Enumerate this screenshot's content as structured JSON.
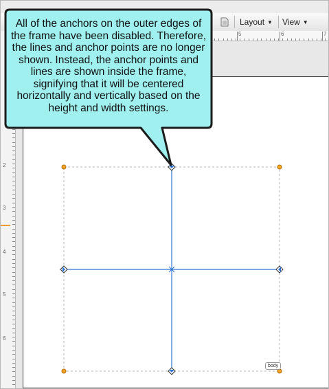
{
  "toolbar": {
    "layout_label": "Layout",
    "view_label": "View"
  },
  "ruler": {
    "h_numbers": [
      "5",
      "6",
      "7"
    ],
    "v_numbers": [
      "2",
      "3",
      "4",
      "5",
      "6"
    ]
  },
  "callout": {
    "text": "All of the anchors on the outer edges of the frame have been disabled. Therefore, the lines and anchor points are no longer shown. Instead, the anchor points and lines are shown inside the frame, signifying that it will be centered horizontally and vertically based on the height and width settings."
  },
  "frame_tag": {
    "label": "body"
  },
  "colors": {
    "callout_fill": "#9ff0ef",
    "guide_line": "#2f74d0",
    "corner_anchor": "#f5a623"
  }
}
